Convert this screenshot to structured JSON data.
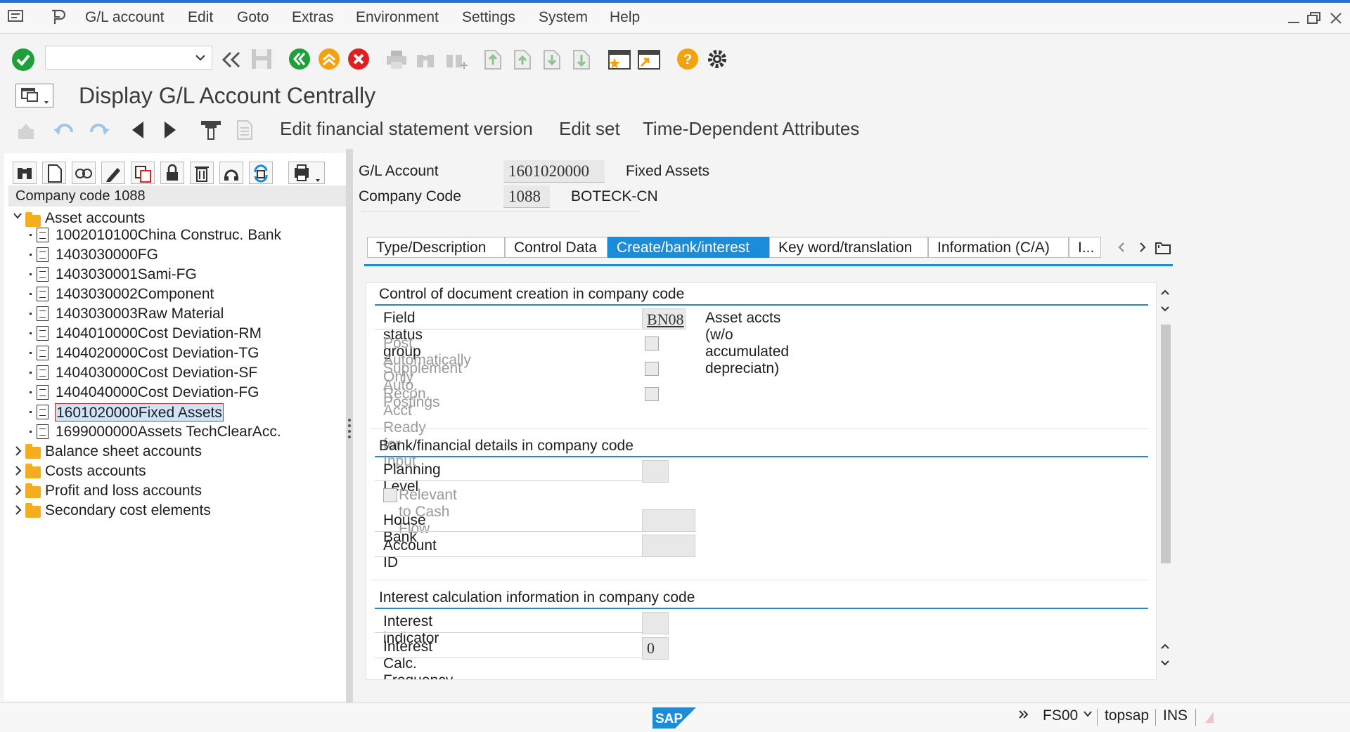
{
  "menu": [
    "G/L account",
    "Edit",
    "Goto",
    "Extras",
    "Environment",
    "Settings",
    "System",
    "Help"
  ],
  "title": "Display G/L Account Centrally",
  "app_toolbar": {
    "edit_fsv": "Edit financial statement version",
    "edit_set": "Edit set",
    "time_dep": "Time-Dependent Attributes"
  },
  "tree": {
    "header": "Company code 1088",
    "asset_folder": "Asset accounts",
    "items": [
      "1002010100China Construc. Bank",
      "1403030000FG",
      "1403030001Sami-FG",
      "1403030002Component",
      "1403030003Raw Material",
      "1404010000Cost Deviation-RM",
      "1404020000Cost Deviation-TG",
      "1404030000Cost Deviation-SF",
      "1404040000Cost Deviation-FG",
      "1601020000Fixed Assets",
      "1699000000Assets TechClearAcc."
    ],
    "selected_index": 9,
    "folders": [
      "Balance sheet accounts",
      "Costs accounts",
      "Profit and loss accounts",
      "Secondary cost elements"
    ]
  },
  "header_fields": {
    "gl_label": "G/L Account",
    "gl_value": "1601020000",
    "gl_desc": "Fixed Assets",
    "cc_label": "Company Code",
    "cc_value": "1088",
    "cc_desc": "BOTECK-CN"
  },
  "tabs": [
    "Type/Description",
    "Control Data",
    "Create/bank/interest",
    "Key word/translation",
    "Information (C/A)",
    "I..."
  ],
  "active_tab": "Create/bank/interest",
  "section1": {
    "title": "Control of document creation in company code",
    "fsg_label": "Field status group",
    "fsg_value": "BN08",
    "fsg_desc": "Asset accts (w/o accumulated depreciatn)",
    "post_auto": "Post Automatically Only",
    "supp_auto": "Supplement Auto. Postings",
    "recon_ready": "Recon. Acct Ready for Input"
  },
  "section2": {
    "title": "Bank/financial details in company code",
    "planning_level": "Planning Level",
    "relevant_cf": "Relevant to Cash Flow",
    "house_bank": "House Bank",
    "account_id": "Account ID"
  },
  "section3": {
    "title": "Interest calculation information in company code",
    "int_indicator": "Interest indicator",
    "int_freq": "Interest Calc. Frequency",
    "int_freq_value": "0"
  },
  "status": {
    "tcode": "FS00",
    "server": "topsap",
    "mode": "INS"
  },
  "colors": {
    "accent": "#1a8cd8",
    "ok": "#1e9f3a",
    "cancel": "#e02020",
    "nav_green": "#1e9f3a",
    "nav_orange": "#f3a10c",
    "help": "#f3a10c"
  }
}
